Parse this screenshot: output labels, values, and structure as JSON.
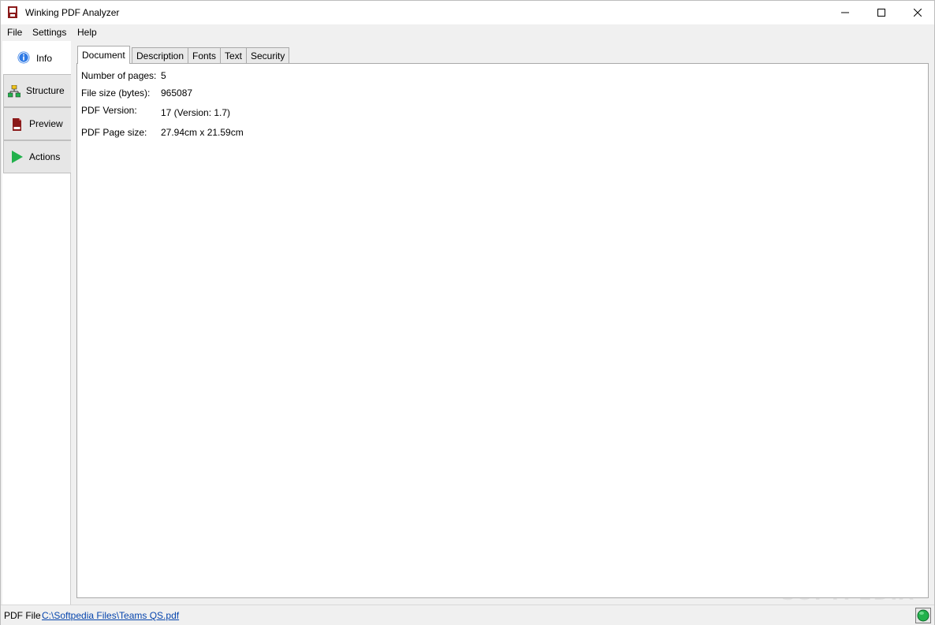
{
  "window": {
    "title": "Winking PDF Analyzer",
    "controls": [
      "minimize-icon",
      "maximize-icon",
      "close-icon"
    ]
  },
  "menu": {
    "items": [
      "File",
      "Settings",
      "Help"
    ]
  },
  "nav": {
    "items": [
      {
        "label": "Info",
        "icon": "info-icon",
        "active": true
      },
      {
        "label": "Structure",
        "icon": "structure-icon",
        "active": false
      },
      {
        "label": "Preview",
        "icon": "pdf-file-icon",
        "active": false
      },
      {
        "label": "Actions",
        "icon": "play-icon",
        "active": false
      }
    ]
  },
  "tabs": {
    "items": [
      "Document",
      "Description",
      "Fonts",
      "Text",
      "Security"
    ],
    "active": "Document"
  },
  "document_info": {
    "rows": [
      {
        "label": "Number of pages:",
        "value": "5"
      },
      {
        "label": "File size (bytes):",
        "value": "965087"
      },
      {
        "label": "PDF Version:",
        "value": "17 (Version: 1.7)"
      },
      {
        "label": "PDF Page size:",
        "value": "27.94cm x 21.59cm"
      }
    ]
  },
  "status": {
    "label": "PDF File",
    "path": "C:\\Softpedia Files\\Teams QS.pdf",
    "indicator_color": "#22b14c"
  },
  "colors": {
    "link": "#0645ad",
    "info_icon": "#2f7ae5",
    "play_icon": "#22b14c",
    "pdf_icon": "#8b1a1a"
  }
}
